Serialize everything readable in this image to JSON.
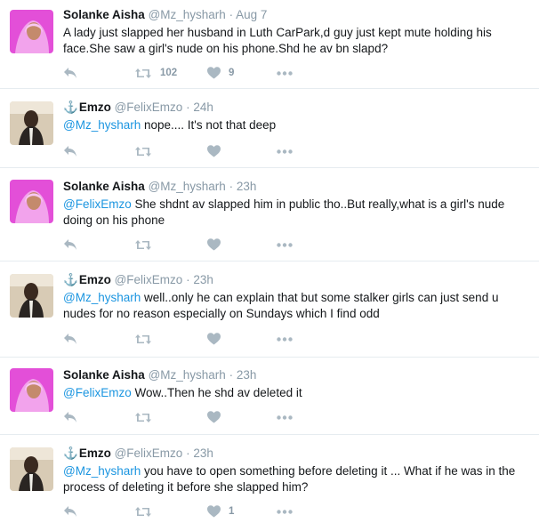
{
  "colors": {
    "link": "#1b95e0",
    "muted": "#8899a6",
    "divider": "#e6ecf0",
    "icon": "#aab8c2"
  },
  "icons": [
    "reply-icon",
    "retweet-icon",
    "like-icon",
    "more-icon",
    "anchor-icon"
  ],
  "tweets": [
    {
      "name": "Solanke Aisha",
      "anchor": "",
      "handle": "@Mz_hysharh",
      "dot": "·",
      "time": "Aug 7",
      "mention": "",
      "body": "A lady just slapped her husband in Luth CarPark,d guy just kept mute holding his face.She saw a girl's nude on his phone.Shd he av bn slapd?",
      "retweets": "102",
      "likes": "9"
    },
    {
      "name": "Emzo",
      "anchor": "⚓",
      "handle": "@FelixEmzo",
      "dot": "·",
      "time": "24h",
      "mention": "@Mz_hysharh",
      "body": " nope.... It's not that deep",
      "retweets": "",
      "likes": ""
    },
    {
      "name": "Solanke Aisha",
      "anchor": "",
      "handle": "@Mz_hysharh",
      "dot": "·",
      "time": "23h",
      "mention": "@FelixEmzo",
      "body": " She shdnt av slapped him in public tho..But really,what is a girl's nude doing on his phone",
      "retweets": "",
      "likes": ""
    },
    {
      "name": "Emzo",
      "anchor": "⚓",
      "handle": "@FelixEmzo",
      "dot": "·",
      "time": "23h",
      "mention": "@Mz_hysharh",
      "body": " well..only he can explain that but some stalker girls can just send u nudes for no reason especially on Sundays which I find odd",
      "retweets": "",
      "likes": ""
    },
    {
      "name": "Solanke Aisha",
      "anchor": "",
      "handle": "@Mz_hysharh",
      "dot": "·",
      "time": "23h",
      "mention": "@FelixEmzo",
      "body": " Wow..Then he shd av deleted it",
      "retweets": "",
      "likes": ""
    },
    {
      "name": "Emzo",
      "anchor": "⚓",
      "handle": "@FelixEmzo",
      "dot": "·",
      "time": "23h",
      "mention": "@Mz_hysharh",
      "body": " you have to open something before deleting it ... What if he was in the process of deleting it before she slapped him?",
      "retweets": "",
      "likes": "1"
    }
  ]
}
